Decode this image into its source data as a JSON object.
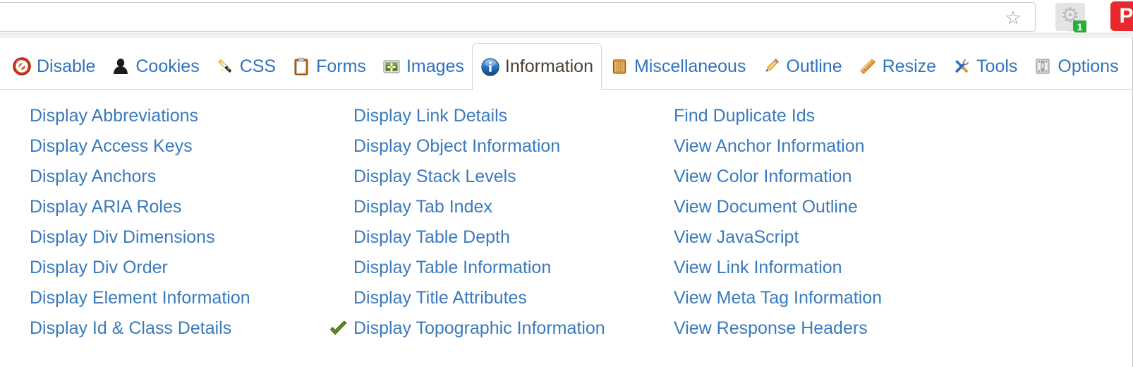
{
  "browser": {
    "omnibox": {
      "value": "",
      "placeholder": ""
    },
    "bookmark_star_icon": "star-icon",
    "extensions": [
      {
        "name": "web-developer-toolbar",
        "icon": "gear-icon",
        "badge": "1",
        "badge_color": "#2aad3f",
        "active": true
      },
      {
        "name": "pdf-extension",
        "icon": "red-square-icon",
        "label": "P",
        "color": "#e8292f"
      }
    ]
  },
  "toolbar": {
    "tabs": [
      {
        "id": "disable",
        "label": "Disable",
        "icon": "no-entry-icon",
        "active": false
      },
      {
        "id": "cookies",
        "label": "Cookies",
        "icon": "user-icon",
        "active": false
      },
      {
        "id": "css",
        "label": "CSS",
        "icon": "magic-wand-icon",
        "active": false
      },
      {
        "id": "forms",
        "label": "Forms",
        "icon": "clipboard-icon",
        "active": false
      },
      {
        "id": "images",
        "label": "Images",
        "icon": "picture-icon",
        "active": false
      },
      {
        "id": "information",
        "label": "Information",
        "icon": "info-circle-icon",
        "active": true
      },
      {
        "id": "miscellaneous",
        "label": "Miscellaneous",
        "icon": "crate-icon",
        "active": false
      },
      {
        "id": "outline",
        "label": "Outline",
        "icon": "pencil-icon",
        "active": false
      },
      {
        "id": "resize",
        "label": "Resize",
        "icon": "ruler-icon",
        "active": false
      },
      {
        "id": "tools",
        "label": "Tools",
        "icon": "wrench-screwdriver-icon",
        "active": false
      },
      {
        "id": "options",
        "label": "Options",
        "icon": "toggle-switch-icon",
        "active": false
      }
    ]
  },
  "information_panel": {
    "columns": [
      {
        "items": [
          {
            "label": "Display Abbreviations",
            "checked": false
          },
          {
            "label": "Display Access Keys",
            "checked": false
          },
          {
            "label": "Display Anchors",
            "checked": false
          },
          {
            "label": "Display ARIA Roles",
            "checked": false
          },
          {
            "label": "Display Div Dimensions",
            "checked": false
          },
          {
            "label": "Display Div Order",
            "checked": false
          },
          {
            "label": "Display Element Information",
            "checked": false
          },
          {
            "label": "Display Id & Class Details",
            "checked": false
          }
        ]
      },
      {
        "items": [
          {
            "label": "Display Link Details",
            "checked": false
          },
          {
            "label": "Display Object Information",
            "checked": false
          },
          {
            "label": "Display Stack Levels",
            "checked": false
          },
          {
            "label": "Display Tab Index",
            "checked": false
          },
          {
            "label": "Display Table Depth",
            "checked": false
          },
          {
            "label": "Display Table Information",
            "checked": false
          },
          {
            "label": "Display Title Attributes",
            "checked": false
          },
          {
            "label": "Display Topographic Information",
            "checked": true
          }
        ]
      },
      {
        "items": [
          {
            "label": "Find Duplicate Ids",
            "checked": false
          },
          {
            "label": "View Anchor Information",
            "checked": false
          },
          {
            "label": "View Color Information",
            "checked": false
          },
          {
            "label": "View Document Outline",
            "checked": false
          },
          {
            "label": "View JavaScript",
            "checked": false
          },
          {
            "label": "View Link Information",
            "checked": false
          },
          {
            "label": "View Meta Tag Information",
            "checked": false
          },
          {
            "label": "View Response Headers",
            "checked": false
          }
        ]
      }
    ]
  },
  "colors": {
    "link": "#3a7abd",
    "tab_link": "#2f73bb",
    "active_tab_text": "#4a3f36",
    "check_green": "#5d8c1e",
    "badge_green": "#2aad3f",
    "panel_border": "#d4d4d4"
  }
}
